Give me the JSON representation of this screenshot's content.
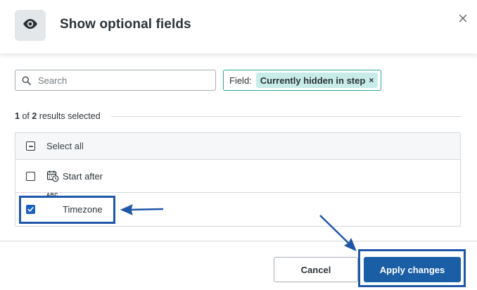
{
  "dialog": {
    "title": "Show optional fields",
    "icon": "eye-icon",
    "close_icon": "close-icon"
  },
  "search": {
    "placeholder": "Search",
    "value": ""
  },
  "filter": {
    "label": "Field:",
    "value": "Currently hidden in step",
    "remove_symbol": "×"
  },
  "results": {
    "selected": "1",
    "of_text": "of",
    "total": "2",
    "suffix": "results selected"
  },
  "list": {
    "select_all": {
      "label": "Select all",
      "state": "indeterminate"
    },
    "items": [
      {
        "label": "Start after",
        "icon": "calendar-clock-icon",
        "checked": false
      },
      {
        "label": "Timezone",
        "icon": "abc-text-icon",
        "icon_text": "ABC",
        "checked": true
      }
    ]
  },
  "footer": {
    "cancel_label": "Cancel",
    "apply_label": "Apply changes"
  },
  "colors": {
    "primary": "#1a5fa5",
    "checkbox_checked": "#1a5fc4",
    "chip_border": "#2aa59a",
    "chip_fill": "#c8ecea",
    "annotation": "#1f57a8"
  }
}
